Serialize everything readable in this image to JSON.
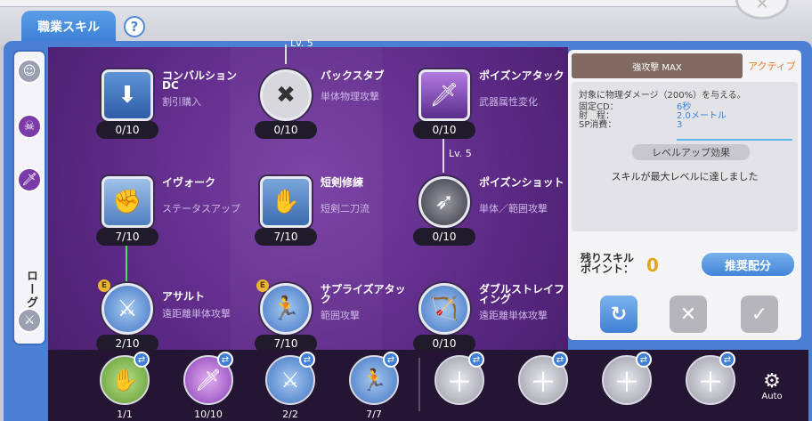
{
  "header": {
    "tab_label": "職業スキル",
    "help_label": "?"
  },
  "sidebar": {
    "job_label": "ローグ"
  },
  "skills": [
    {
      "name": "コンバルション DC",
      "desc": "割引購入",
      "level": "0/10"
    },
    {
      "name": "バックスタブ",
      "desc": "単体物理攻撃",
      "level": "0/10"
    },
    {
      "name": "ポイズンアタック",
      "desc": "武器属性変化",
      "level": "0/10"
    },
    {
      "name": "イヴォーク",
      "desc": "ステータスアップ",
      "level": "7/10"
    },
    {
      "name": "短剣修練",
      "desc": "短剣二刀流",
      "level": "7/10"
    },
    {
      "name": "ポイズンショット",
      "desc": "単体／範囲攻撃",
      "level": "0/10"
    },
    {
      "name": "アサルト",
      "desc": "遠距離単体攻撃",
      "level": "2/10"
    },
    {
      "name": "サプライズアタック",
      "desc": "範囲攻撃",
      "level": "7/10"
    },
    {
      "name": "ダブルストレイフィング",
      "desc": "遠距離単体攻撃",
      "level": "0/10"
    }
  ],
  "requirements": {
    "top": "Lv. 5",
    "mid": "Lv. 5"
  },
  "panel": {
    "skill_title": "強攻撃 MAX",
    "type_label": "アクティブ",
    "description": "対象に物理ダメージ（200%）を与える。",
    "stats": [
      {
        "key": "固定CD：",
        "value": "6秒"
      },
      {
        "key": "射　程：",
        "value": "2.0メートル"
      },
      {
        "key": "SP消費：",
        "value": "3"
      }
    ],
    "levelup_label": "レベルアップ効果",
    "max_message": "スキルが最大レベルに達しました",
    "remaining_label": "残りスキル ポイント：",
    "remaining_value": "0",
    "recommend_button": "推奨配分"
  },
  "hotbar": {
    "slots": [
      {
        "count": "1/1"
      },
      {
        "count": "10/10"
      },
      {
        "count": "2/2"
      },
      {
        "count": "7/7"
      },
      {
        "count": ""
      },
      {
        "count": ""
      },
      {
        "count": ""
      },
      {
        "count": ""
      }
    ],
    "auto_label": "Auto"
  },
  "colors": {
    "accent": "#4a7fd3",
    "tree_bg": "#5e2b88",
    "active": "#f07a2a",
    "points": "#e0a820"
  }
}
